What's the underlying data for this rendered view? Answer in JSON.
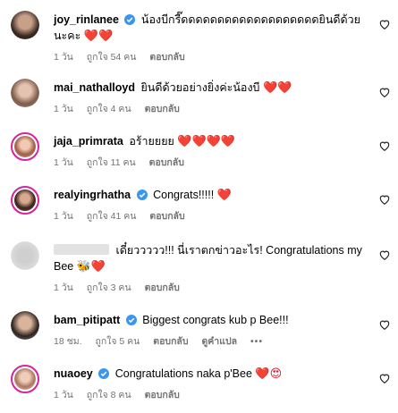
{
  "colors": {
    "heart": "#e0142a",
    "verified": "#3897f0",
    "meta": "#737373",
    "story_ring": "#d6249f"
  },
  "comments": [
    {
      "username": "joy_rinlanee",
      "verified": true,
      "text": "น้องบีกรี๊ดดดดดดดดดดดดดดดดดดดยินดีด้วยนะคะ",
      "emoji": "❤️❤️",
      "time": "1 วัน",
      "likes": "ถูกใจ 54 คน",
      "reply": "ตอบกลับ"
    },
    {
      "username": "mai_nathalloyd",
      "verified": false,
      "text": "ยินดีด้วยอย่างยิ่งค่ะน้องบี",
      "emoji": "❤️❤️",
      "time": "1 วัน",
      "likes": "ถูกใจ 4 คน",
      "reply": "ตอบกลับ"
    },
    {
      "username": "jaja_primrata",
      "verified": false,
      "text": "อร้ายยยย",
      "emoji": "❤️❤️❤️❤️",
      "time": "1 วัน",
      "likes": "ถูกใจ 11 คน",
      "reply": "ตอบกลับ"
    },
    {
      "username": "realyingrhatha",
      "verified": true,
      "text": "Congrats!!!!!",
      "emoji": "❤️",
      "time": "1 วัน",
      "likes": "ถูกใจ 41 คน",
      "reply": "ตอบกลับ"
    },
    {
      "username": "",
      "verified": false,
      "text": "เดี๋ยววววว!!! นี่เราตกข่าวอะไร! Congratulations my Bee",
      "emoji": "🐝❤️",
      "time": "1 วัน",
      "likes": "ถูกใจ 3 คน",
      "reply": "ตอบกลับ"
    },
    {
      "username": "bam_pitipatt",
      "verified": true,
      "text": "Biggest congrats kub p Bee!!!",
      "emoji": "",
      "time": "18 ชม.",
      "likes": "ถูกใจ 5 คน",
      "reply": "ตอบกลับ",
      "translate": "ดูคำแปล",
      "more": "•••"
    },
    {
      "username": "nuaoey",
      "verified": true,
      "text": "Congratulations naka p'Bee",
      "emoji": "❤️😍",
      "time": "1 วัน",
      "likes": "ถูกใจ 8 คน",
      "reply": "ตอบกลับ"
    }
  ]
}
